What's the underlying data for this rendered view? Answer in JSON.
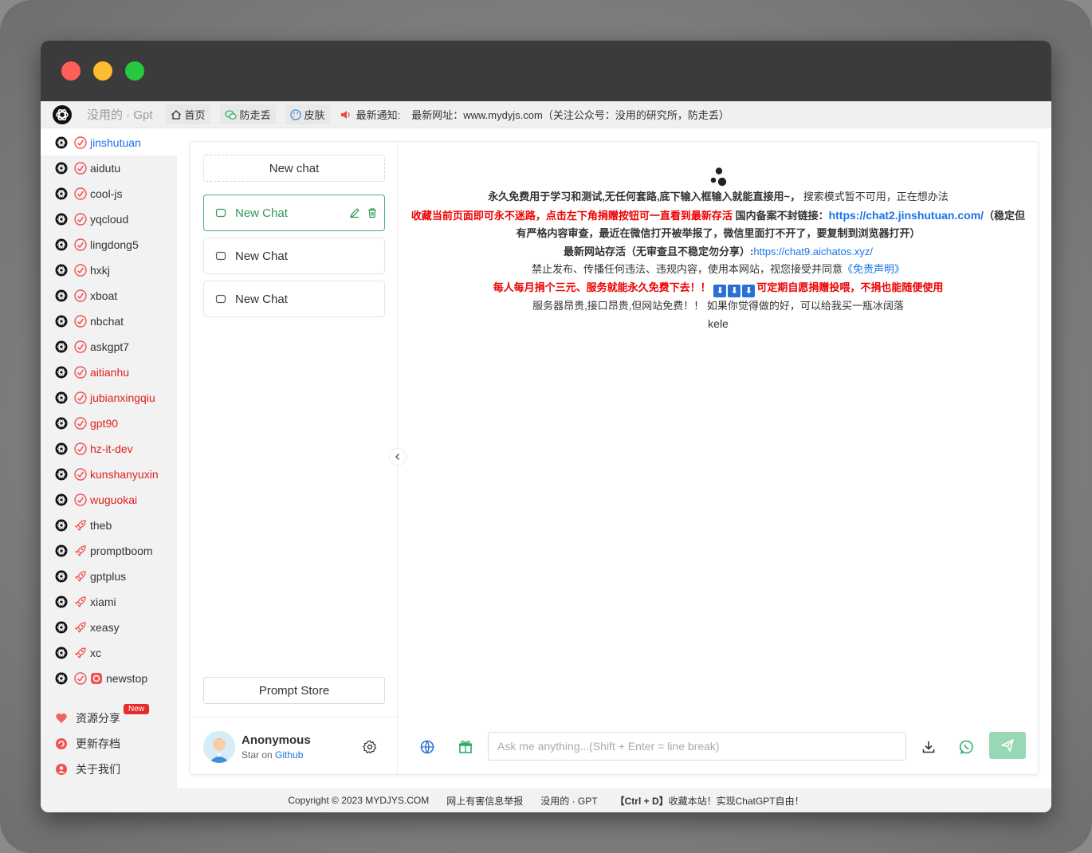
{
  "window": {
    "controls": [
      "close",
      "minimize",
      "maximize"
    ]
  },
  "topnav": {
    "brand": "没用的 · Gpt",
    "home": "首页",
    "anti_lost": "防走丢",
    "skin": "皮肤",
    "notice_label": "最新通知:",
    "notice_text": "最新网址：www.mydyjs.com（关注公众号：没用的研究所，防走丢）"
  },
  "sidebar": {
    "items": [
      {
        "label": "jinshutuan",
        "style": "active",
        "badge": "check"
      },
      {
        "label": "aidutu",
        "style": "normal",
        "badge": "check"
      },
      {
        "label": "cool-js",
        "style": "normal",
        "badge": "check"
      },
      {
        "label": "yqcloud",
        "style": "normal",
        "badge": "check"
      },
      {
        "label": "lingdong5",
        "style": "normal",
        "badge": "check"
      },
      {
        "label": "hxkj",
        "style": "normal",
        "badge": "check"
      },
      {
        "label": "xboat",
        "style": "normal",
        "badge": "check"
      },
      {
        "label": "nbchat",
        "style": "normal",
        "badge": "check"
      },
      {
        "label": "askgpt7",
        "style": "normal",
        "badge": "check"
      },
      {
        "label": "aitianhu",
        "style": "red",
        "badge": "check"
      },
      {
        "label": "jubianxingqiu",
        "style": "red",
        "badge": "check"
      },
      {
        "label": "gpt90",
        "style": "red",
        "badge": "check"
      },
      {
        "label": "hz-it-dev",
        "style": "red",
        "badge": "check"
      },
      {
        "label": "kunshanyuxin",
        "style": "red",
        "badge": "check"
      },
      {
        "label": "wuguokai",
        "style": "red",
        "badge": "check"
      },
      {
        "label": "theb",
        "style": "normal",
        "badge": "rocket"
      },
      {
        "label": "promptboom",
        "style": "normal",
        "badge": "rocket"
      },
      {
        "label": "gptplus",
        "style": "normal",
        "badge": "rocket"
      },
      {
        "label": "xiami",
        "style": "normal",
        "badge": "rocket"
      },
      {
        "label": "xeasy",
        "style": "normal",
        "badge": "rocket"
      },
      {
        "label": "xc",
        "style": "normal",
        "badge": "rocket"
      },
      {
        "label": "newstop",
        "style": "normal",
        "badge": "check-link"
      }
    ],
    "bottom": [
      {
        "label": "资源分享",
        "icon": "heart-icon"
      },
      {
        "label": "更新存档",
        "icon": "archive-icon"
      },
      {
        "label": "关于我们",
        "icon": "user-icon"
      }
    ],
    "new_tag": "New"
  },
  "chatlist": {
    "new_chat": "New chat",
    "chats": [
      {
        "title": "New Chat",
        "active": true
      },
      {
        "title": "New Chat",
        "active": false
      },
      {
        "title": "New Chat",
        "active": false
      }
    ],
    "prompt_store": "Prompt Store",
    "user": {
      "name": "Anonymous",
      "sub_prefix": "Star on ",
      "sub_link": "Github"
    }
  },
  "intro": {
    "line1": "永久免费用于学习和测试,无任何套路,底下输入框输入就能直接用~，",
    "line1b": "搜索模式暂不可用，正在想办法",
    "line2_red": "收藏当前页面即可永不迷路，点击左下角捐赠按钮可一直看到最新存活",
    "line2_bold": "国内备案不封链接：",
    "line2_link": "https://chat2.jinshutuan.com/",
    "line3": "（稳定但有严格内容审查，最近在微信打开被举报了，微信里面打不开了，要复制到浏览器打开）",
    "line4_bold": "最新网站存活（无审查且不稳定勿分享）:",
    "line4_link": "https://chat9.aichatos.xyz/",
    "line5": "禁止发布、传播任何违法、违规内容，使用本网站，视您接受并同意",
    "line5_link": "《免责声明》",
    "line6_a": "每人每月捐个三元、服务就能永久免费下去！！",
    "line6_b": "可定期自愿捐赠投喂，不捐也能随便使用",
    "line7": "服务器昂贵,接口昂贵,但网站免费！！ 如果你觉得做的好，可以给我买一瓶冰阔落",
    "line8": "kele"
  },
  "input": {
    "placeholder": "Ask me anything...(Shift + Enter = line break)",
    "value": ""
  },
  "footer": {
    "copyright": "Copyright © 2023 MYDJYS.COM",
    "report": "网上有害信息举报",
    "brand": "没用的 · GPT",
    "tip_key": "【Ctrl + D】",
    "tip_text": "收藏本站！实现ChatGPT自由！"
  },
  "colors": {
    "accent_green": "#2e9a55",
    "send_button": "#99d8b4",
    "link_blue": "#1a73e8",
    "warn_red": "#e00000"
  }
}
